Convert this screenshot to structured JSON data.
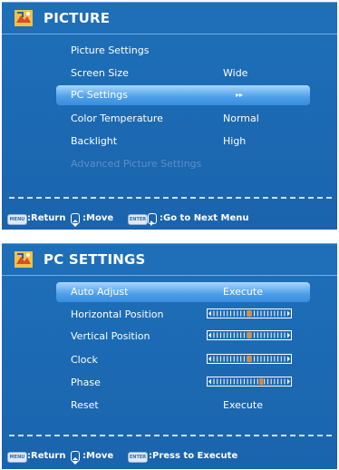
{
  "picture_menu": {
    "title": "PICTURE",
    "items": [
      {
        "label": "Picture Settings",
        "value": ""
      },
      {
        "label": "Screen Size",
        "value": "Wide"
      },
      {
        "label": "PC Settings",
        "value": "▸▸"
      },
      {
        "label": "Color Temperature",
        "value": "Normal"
      },
      {
        "label": "Backlight",
        "value": "High"
      },
      {
        "label": "Advanced Picture Settings",
        "value": ""
      }
    ],
    "footer": {
      "return_key": "MENU",
      "return_label": ":Return",
      "move_label": ":Move",
      "enter_key": "ENTER",
      "next_label": ":Go to Next Menu"
    }
  },
  "pc_menu": {
    "title": "PC SETTINGS",
    "items": [
      {
        "label": "Auto Adjust",
        "value": "Execute"
      },
      {
        "label": "Horizontal Position",
        "slider_level": 0.5
      },
      {
        "label": "Vertical Position",
        "slider_level": 0.5
      },
      {
        "label": "Clock",
        "slider_level": 0.5
      },
      {
        "label": "Phase",
        "slider_level": 0.67
      },
      {
        "label": "Reset",
        "value": "Execute"
      }
    ],
    "footer": {
      "return_key": "MENU",
      "return_label": ":Return",
      "move_label": ":Move",
      "enter_key": "ENTER",
      "execute_label": ":Press to Execute"
    }
  },
  "colors": {
    "panel_blue": "#1e6fb9",
    "highlight": "#4c9ee8",
    "slider_marker": "#e88a2a"
  }
}
